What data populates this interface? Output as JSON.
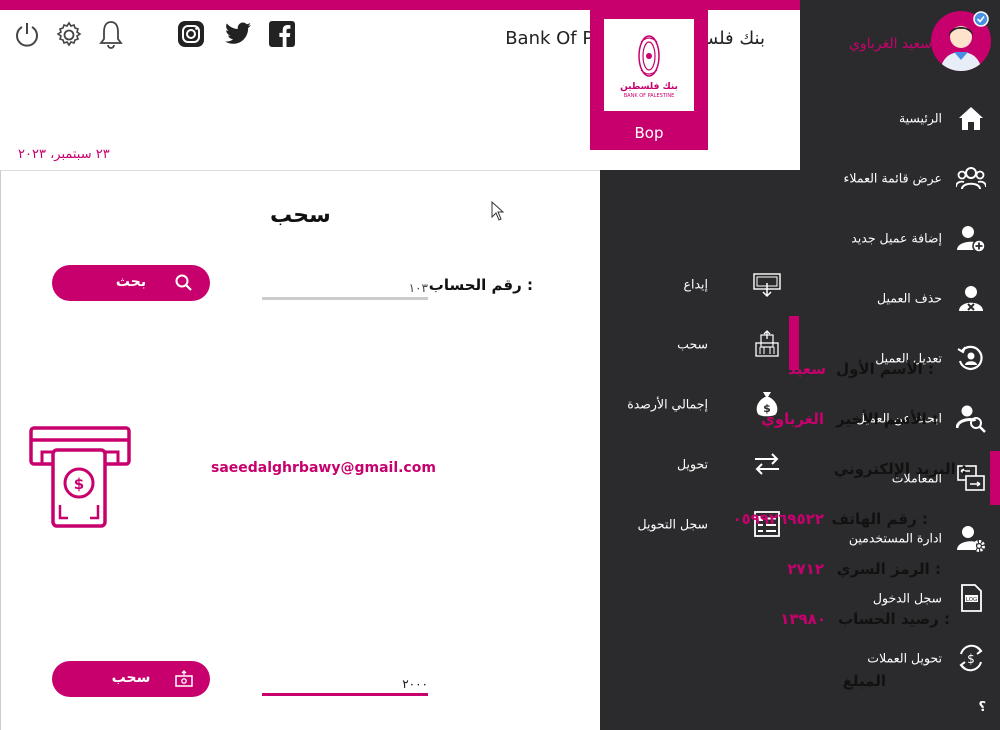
{
  "header": {
    "bank_name": "Bank Of Palestine بنك فلسطين",
    "logo_text_ar": "بنك فلسطين",
    "logo_text_en": "BANK OF PALESTINE",
    "logo_caption": "Bop",
    "date": "٢٣ سبتمبر، ٢٠٢٣"
  },
  "user": {
    "name": "سعيد الغرباوي"
  },
  "sidebar": {
    "items": [
      {
        "label": "الرئيسية",
        "icon": "home-icon"
      },
      {
        "label": "عرض قائمة العملاء",
        "icon": "users-icon"
      },
      {
        "label": "إضافة عميل جديد",
        "icon": "user-add-icon"
      },
      {
        "label": "حذف العميل",
        "icon": "user-delete-icon"
      },
      {
        "label": "تعديل العميل",
        "icon": "user-edit-icon"
      },
      {
        "label": "ابحث عن العميل",
        "icon": "user-search-icon"
      },
      {
        "label": "المعاملات",
        "icon": "transactions-icon"
      },
      {
        "label": "ادارة المستخدمين",
        "icon": "user-settings-icon"
      },
      {
        "label": "سجل الدخول",
        "icon": "log-icon"
      },
      {
        "label": "تحويل العملات",
        "icon": "currency-exchange-icon"
      }
    ],
    "help": "؟"
  },
  "subnav": {
    "items": [
      {
        "label": "إيداع",
        "icon": "deposit-icon"
      },
      {
        "label": "سحب",
        "icon": "withdraw-icon"
      },
      {
        "label": "إجمالي الأرصدة",
        "icon": "money-bag-icon"
      },
      {
        "label": "تحويل",
        "icon": "transfer-icon"
      },
      {
        "label": "سجل التحويل",
        "icon": "transfer-log-icon"
      }
    ]
  },
  "form": {
    "title": "سحب",
    "account_label": "رقم الحساب :",
    "account_value": "١٠٣",
    "search_button": "بحث",
    "first_name_label": "الأسم الأول :",
    "first_name": "سعيد",
    "last_name_label": "الأسم الأخير :",
    "last_name": "الغرباوي",
    "email_label": "البريد الإلكتروني :",
    "email": "saeedalghrbawy@gmail.com",
    "phone_label": "رقم الهاتف :",
    "phone": "٠٥٩٩٢٦٩٥٢٢",
    "pin_label": "الرمز السري :",
    "pin": "٢٧١٢",
    "balance_label": "رصيد الحساب :",
    "balance": "١٣٩٨٠",
    "amount_label": "المبلغ",
    "amount_value": "٢٠٠٠",
    "withdraw_button": "سحب"
  },
  "colors": {
    "accent": "#c8006e",
    "sidebar": "#2b2b2d"
  }
}
